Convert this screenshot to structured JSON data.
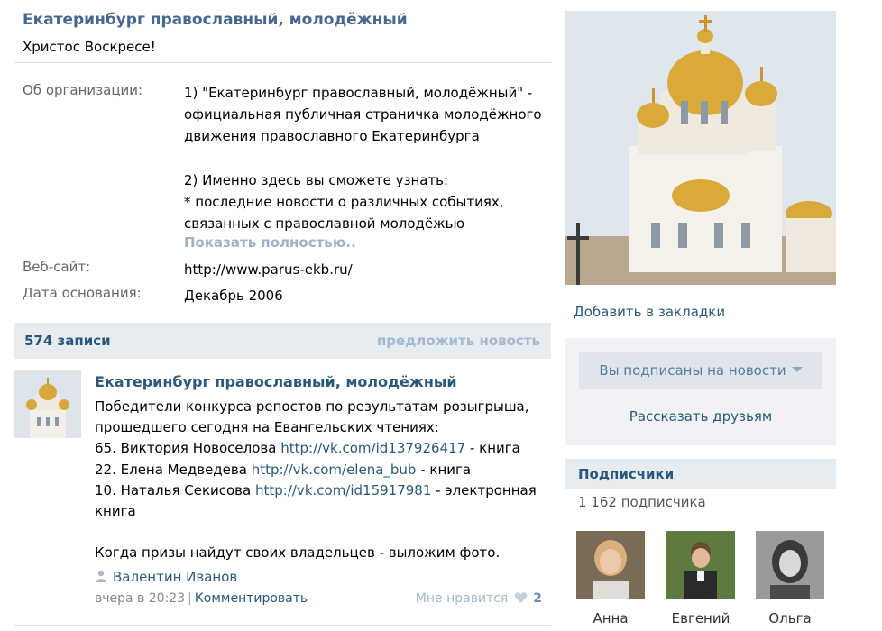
{
  "page": {
    "name": "Екатеринбург православный, молодёжный",
    "status": "Христос Воскресе!"
  },
  "info": {
    "about_label": "Об организации:",
    "about_lines": [
      "1) \"Екатеринбург православный, молодёжный\" -",
      "официальная публичная страничка молодёжного",
      "движения православного Екатеринбурга",
      "",
      "2) Именно здесь вы сможете узнать:",
      "* последние новости о различных событиях,",
      "связанных с православной молодёжью"
    ],
    "show_more": "Показать полностью..",
    "website_label": "Веб-сайт:",
    "website_value": "http://www.parus-ekb.ru/",
    "founded_label": "Дата основания:",
    "founded_value": "Декабрь 2006"
  },
  "wall": {
    "count": "574 записи",
    "suggest": "предложить новость"
  },
  "post": {
    "author": "Екатеринбург православный, молодёжный",
    "lines": [
      [
        {
          "t": "Победители конкурса репостов по результатам розыгрыша,"
        }
      ],
      [
        {
          "t": "прошедшего сегодня на Евангельских чтениях:"
        }
      ],
      [
        {
          "t": "65. Виктория Новоселова "
        },
        {
          "t": "http://vk.com/id137926417",
          "link": true
        },
        {
          "t": " - книга"
        }
      ],
      [
        {
          "t": "22. Елена Медведева "
        },
        {
          "t": "http://vk.com/elena_bub",
          "link": true
        },
        {
          "t": " - книга"
        }
      ],
      [
        {
          "t": "10. Наталья Секисова "
        },
        {
          "t": "http://vk.com/id15917981",
          "link": true
        },
        {
          "t": " - электронная"
        }
      ],
      [
        {
          "t": "книга"
        }
      ],
      [
        {
          "t": ""
        }
      ],
      [
        {
          "t": "Когда призы найдут своих владельцев - выложим фото."
        }
      ]
    ],
    "signer": "Валентин Иванов",
    "time": "вчера в 20:23",
    "separator": "|",
    "comment": "Комментировать",
    "like_label": "Мне нравится",
    "like_count": "2"
  },
  "sidebar": {
    "bookmark": "Добавить в закладки",
    "subscribed_button": "Вы подписаны на новости",
    "tell_friends": "Рассказать друзьям",
    "subscribers_title": "Подписчики",
    "subscribers_count": "1 162 подписчика",
    "subscribers": [
      {
        "name": "Анна"
      },
      {
        "name": "Евгений"
      },
      {
        "name": "Ольга"
      }
    ]
  },
  "colors": {
    "link": "#2b587a",
    "header_bg": "#e7ecf1",
    "muted_link": "#a5b9cc"
  }
}
